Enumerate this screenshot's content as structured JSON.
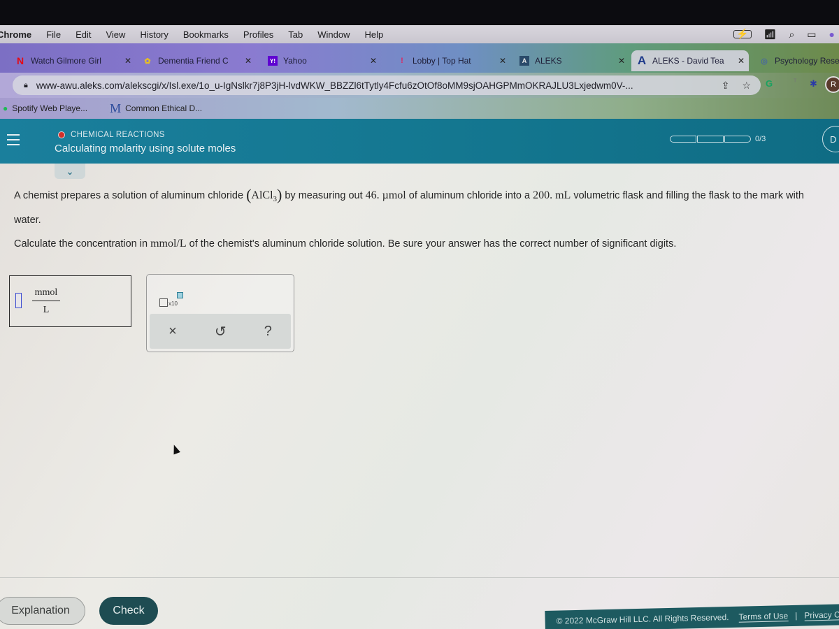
{
  "menubar": {
    "app": "Chrome",
    "items": [
      "File",
      "Edit",
      "View",
      "History",
      "Bookmarks",
      "Profiles",
      "Tab",
      "Window",
      "Help"
    ]
  },
  "tabs": [
    {
      "title": "Watch Gilmore Girl",
      "favicon": "netflix-icon",
      "favicon_glyph": "N",
      "color": "#e50914",
      "active": false
    },
    {
      "title": "Dementia Friend C",
      "favicon": "dementia-friends-icon",
      "favicon_glyph": "✿",
      "color": "#e8c020",
      "active": false
    },
    {
      "title": "Yahoo",
      "favicon": "yahoo-icon",
      "favicon_glyph": "Y!",
      "color": "#5f01d1",
      "active": false
    },
    {
      "title": "Lobby | Top Hat",
      "favicon": "tophat-icon",
      "favicon_glyph": "!",
      "color": "#e0245e",
      "active": false
    },
    {
      "title": "ALEKS",
      "favicon": "aleks-icon",
      "favicon_glyph": "A",
      "color": "#2a4a6a",
      "active": false
    },
    {
      "title": "ALEKS - David Tea",
      "favicon": "aleks-a-icon",
      "favicon_glyph": "A",
      "color": "#1e3a8a",
      "active": true
    },
    {
      "title": "Psychology Resea",
      "favicon": "google-scholar-icon",
      "favicon_glyph": "◎",
      "color": "#4a6a9a",
      "active": false
    }
  ],
  "address_bar": {
    "url": "www-awu.aleks.com/alekscgi/x/Isl.exe/1o_u-IgNslkr7j8P3jH-lvdWKW_BBZZl6tTytly4Fcfu6zOtOf8oMM9sjOAHGPMmOKRAJLU3Lxjedwm0V-..."
  },
  "extensions": {
    "avatar_letter": "R"
  },
  "bookmarks": [
    {
      "label": "Spotify Web Playe...",
      "icon": "spotify-icon"
    },
    {
      "label": "Common Ethical D...",
      "icon": "m-icon"
    }
  ],
  "header": {
    "topic": "CHEMICAL REACTIONS",
    "subtitle": "Calculating molarity using solute moles",
    "progress_text": "0/3",
    "progress_done": 0,
    "progress_total": 3,
    "right_button": "D"
  },
  "question": {
    "part1": "A chemist prepares a solution of aluminum chloride ",
    "formula_main": "AlCl",
    "formula_sub": "3",
    "part2": " by measuring out ",
    "amount": "46. µmol",
    "part3": " of aluminum chloride into a ",
    "volume": "200. mL",
    "part4": " volumetric flask and filling the flask to the mark with water.",
    "line2_a": "Calculate the concentration in ",
    "line2_unit": "mmol/L",
    "line2_b": " of the chemist's aluminum chloride solution. Be sure your answer has the correct number of significant digits."
  },
  "answer": {
    "value": "",
    "unit_numerator": "mmol",
    "unit_denominator": "L"
  },
  "palette": {
    "sci_label": "x10",
    "clear": "×",
    "undo": "↺",
    "help": "?"
  },
  "buttons": {
    "explanation": "Explanation",
    "check": "Check"
  },
  "footer": {
    "copyright": "© 2022 McGraw Hill LLC. All Rights Reserved.",
    "terms": "Terms of Use",
    "separator": "|",
    "privacy": "Privacy C"
  }
}
